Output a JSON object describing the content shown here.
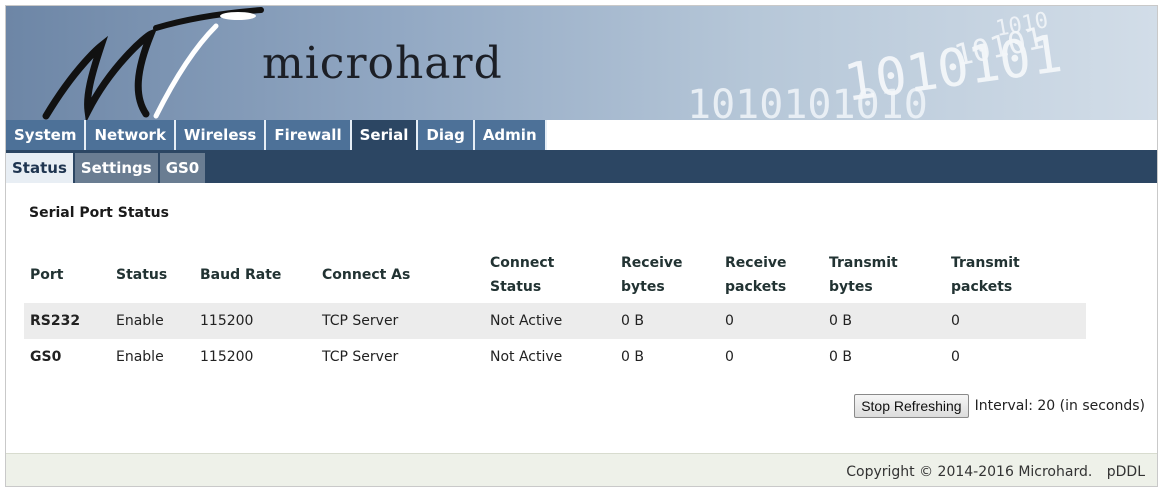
{
  "header": {
    "brand": "microhard",
    "binary_text": "1010101010101010"
  },
  "main_tabs": [
    {
      "label": "System",
      "active": false
    },
    {
      "label": "Network",
      "active": false
    },
    {
      "label": "Wireless",
      "active": false
    },
    {
      "label": "Firewall",
      "active": false
    },
    {
      "label": "Serial",
      "active": true
    },
    {
      "label": "Diag",
      "active": false
    },
    {
      "label": "Admin",
      "active": false
    }
  ],
  "sub_tabs": [
    {
      "label": "Status",
      "active": true
    },
    {
      "label": "Settings",
      "active": false
    },
    {
      "label": "GS0",
      "active": false
    }
  ],
  "section_title": "Serial Port Status",
  "table": {
    "headers": {
      "port": "Port",
      "status": "Status",
      "baud": "Baud Rate",
      "connect_as": "Connect As",
      "connect_status_1": "Connect",
      "connect_status_2": "Status",
      "rx_bytes_1": "Receive",
      "rx_bytes_2": "bytes",
      "rx_packets_1": "Receive",
      "rx_packets_2": "packets",
      "tx_bytes_1": "Transmit",
      "tx_bytes_2": "bytes",
      "tx_packets_1": "Transmit",
      "tx_packets_2": "packets"
    },
    "rows": [
      {
        "port": "RS232",
        "status": "Enable",
        "baud": "115200",
        "connect_as": "TCP Server",
        "connect_status": "Not Active",
        "rx_bytes": "0 B",
        "rx_packets": "0",
        "tx_bytes": "0 B",
        "tx_packets": "0"
      },
      {
        "port": "GS0",
        "status": "Enable",
        "baud": "115200",
        "connect_as": "TCP Server",
        "connect_status": "Not Active",
        "rx_bytes": "0 B",
        "rx_packets": "0",
        "tx_bytes": "0 B",
        "tx_packets": "0"
      }
    ]
  },
  "refresh": {
    "button_label": "Stop Refreshing",
    "interval_text": "Interval: 20 (in seconds)"
  },
  "footer": {
    "copyright": "Copyright © 2014-2016 Microhard.",
    "product": "pDDL"
  },
  "colors": {
    "tab_bg": "#4d7198",
    "tab_active_bg": "#2c4663",
    "subtab_active_bg": "#e8eef4",
    "footer_bg": "#eef1e9"
  }
}
